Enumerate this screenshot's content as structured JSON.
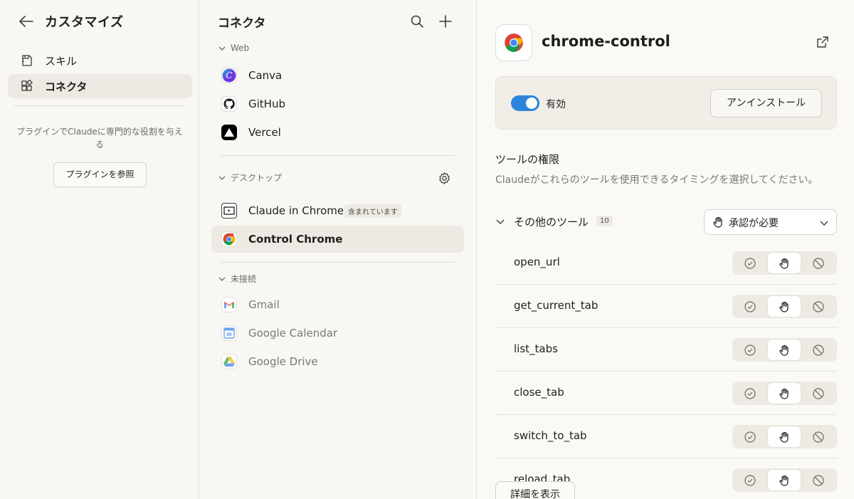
{
  "sidebar": {
    "title": "カスタマイズ",
    "items": [
      {
        "label": "スキル",
        "icon": "skills-icon"
      },
      {
        "label": "コネクタ",
        "icon": "connectors-icon",
        "active": true
      }
    ],
    "promo_text": "プラグインでClaudeに専門的な役割を与える",
    "promo_button": "プラグインを参照"
  },
  "connectors": {
    "title": "コネクタ",
    "sections": [
      {
        "label": "Web",
        "items": [
          {
            "name": "Canva",
            "icon": "canva-icon"
          },
          {
            "name": "GitHub",
            "icon": "github-icon"
          },
          {
            "name": "Vercel",
            "icon": "vercel-icon"
          }
        ]
      },
      {
        "label": "デスクトップ",
        "items": [
          {
            "name": "Claude in Chrome",
            "badge": "含まれています",
            "icon": "claude-in-chrome-icon"
          },
          {
            "name": "Control Chrome",
            "icon": "chrome-icon",
            "selected": true
          }
        ]
      },
      {
        "label": "未接続",
        "items": [
          {
            "name": "Gmail",
            "icon": "gmail-icon"
          },
          {
            "name": "Google Calendar",
            "icon": "google-calendar-icon"
          },
          {
            "name": "Google Drive",
            "icon": "google-drive-icon"
          }
        ]
      }
    ]
  },
  "detail": {
    "title": "chrome-control",
    "enabled_label": "有効",
    "enabled": true,
    "uninstall_label": "アンインストール",
    "permissions_title": "ツールの権限",
    "permissions_desc": "Claudeがこれらのツールを使用できるタイミングを選択してください。",
    "group_label": "その他のツール",
    "group_count": "10",
    "group_approval": "承認が必要",
    "tools": [
      {
        "name": "open_url",
        "mode": "require-approval"
      },
      {
        "name": "get_current_tab",
        "mode": "require-approval"
      },
      {
        "name": "list_tabs",
        "mode": "require-approval"
      },
      {
        "name": "close_tab",
        "mode": "require-approval"
      },
      {
        "name": "switch_to_tab",
        "mode": "require-approval"
      },
      {
        "name": "reload_tab",
        "mode": "require-approval"
      }
    ],
    "show_more_label": "詳細を表示"
  },
  "colors": {
    "accent": "#2c84db",
    "background": "#faf9f5",
    "sidebar_bg": "#f8f7f3",
    "selected_bg": "#eceae3"
  }
}
